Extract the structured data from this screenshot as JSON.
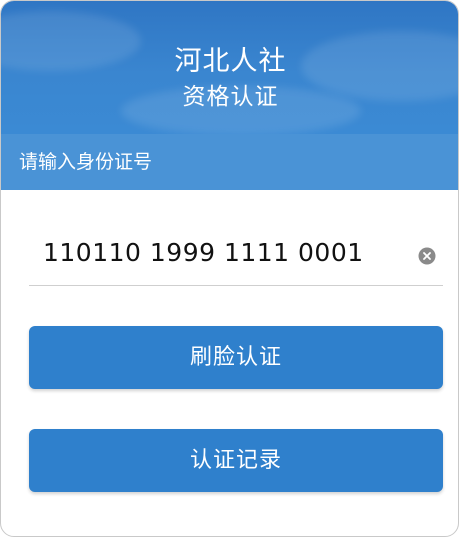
{
  "header": {
    "title": "河北人社",
    "subtitle": "资格认证"
  },
  "hint": {
    "text": "请输入身份证号"
  },
  "id_input": {
    "value": "110110 1999 1111 0001",
    "clear_icon": "clear-circle-icon"
  },
  "buttons": {
    "face_auth_label": "刷脸认证",
    "records_label": "认证记录"
  },
  "colors": {
    "header_blue": "#2f76c4",
    "hint_bar_blue": "#4a93d6",
    "button_blue": "#2f80cc"
  }
}
